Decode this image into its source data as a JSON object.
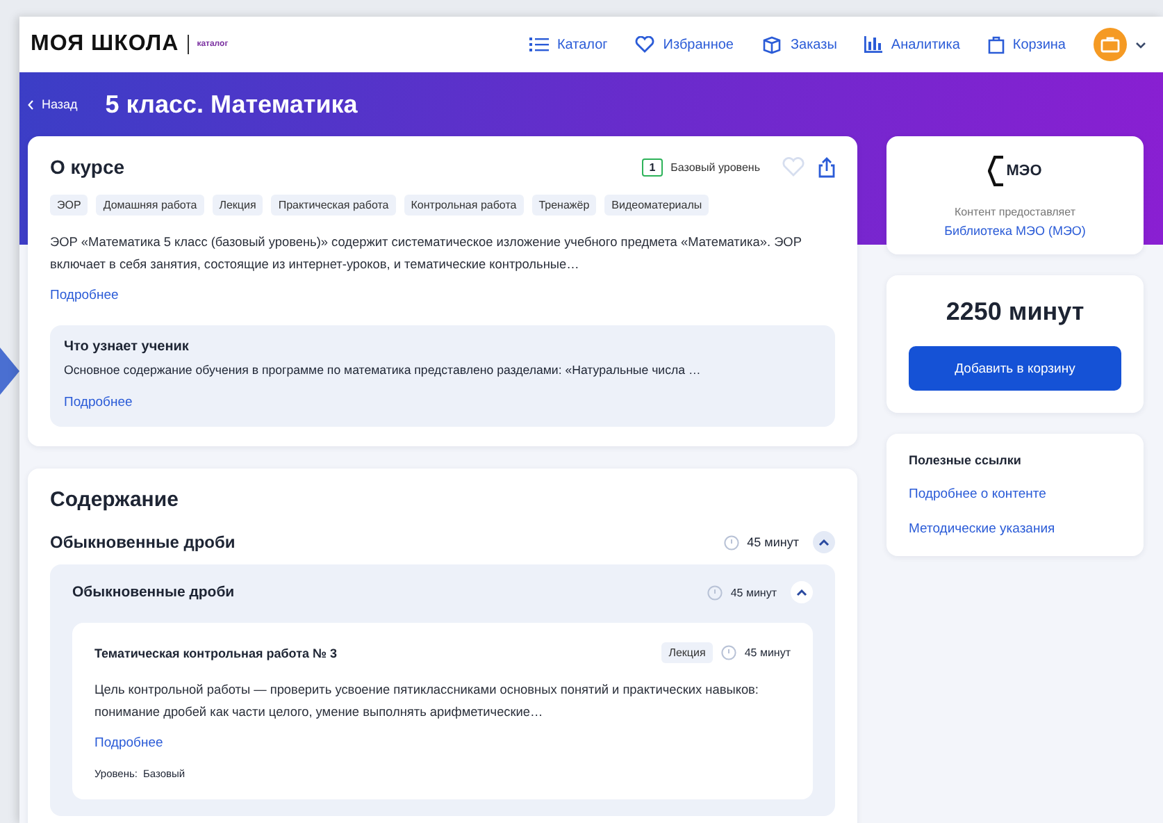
{
  "header": {
    "logo": "МОЯ ШКОЛА",
    "logo_sub": "каталог",
    "nav": [
      {
        "label": "Каталог",
        "kind": "list"
      },
      {
        "label": "Избранное",
        "kind": "heart"
      },
      {
        "label": "Заказы",
        "kind": "box"
      },
      {
        "label": "Аналитика",
        "kind": "chart"
      },
      {
        "label": "Корзина",
        "kind": "bag"
      }
    ]
  },
  "banner": {
    "back": "Назад",
    "title": "5 класс. Математика"
  },
  "about": {
    "title": "О курсе",
    "level_number": "1",
    "level": "Базовый уровень",
    "tags": [
      "ЭОР",
      "Домашняя работа",
      "Лекция",
      "Практическая работа",
      "Контрольная работа",
      "Тренажёр",
      "Видеоматериалы"
    ],
    "description": "ЭОР «Математика 5 класс (базовый уровень)» содержит систематическое изложение учебного предмета «Математика». ЭОР включает в себя занятия, состоящие из интернет-уроков, и тематические контрольные…",
    "more": "Подробнее",
    "learn": {
      "title": "Что узнает ученик",
      "text": "Основное содержание обучения в программе по математика представлено разделами: «Натуральные числа …",
      "more": "Подробнее"
    }
  },
  "contents": {
    "title": "Содержание",
    "sections": [
      {
        "title": "Обыкновенные дроби",
        "duration": "45 минут",
        "expanded": true,
        "children": [
          {
            "title": "Обыкновенные дроби",
            "duration": "45 минут",
            "expanded": true,
            "lessons": [
              {
                "title": "Тематическая контрольная работа № 3",
                "type": "Лекция",
                "duration": "45 минут",
                "text": "Цель контрольной работы — проверить усвоение пятиклассниками основных понятий и практических навыков: понимание дробей как части целого, умение выполнять арифметические…",
                "more": "Подробнее",
                "level_label": "Уровень:",
                "level": "Базовый"
              }
            ]
          }
        ]
      }
    ]
  },
  "provider": {
    "logo": "МЭО",
    "caption": "Контент предоставляет",
    "name": "Библиотека МЭО (МЭО)"
  },
  "price": {
    "amount": "2250 минут",
    "button": "Добавить в корзину"
  },
  "links": {
    "title": "Полезные ссылки",
    "items": [
      "Подробнее о контенте",
      "Методические указания"
    ]
  }
}
